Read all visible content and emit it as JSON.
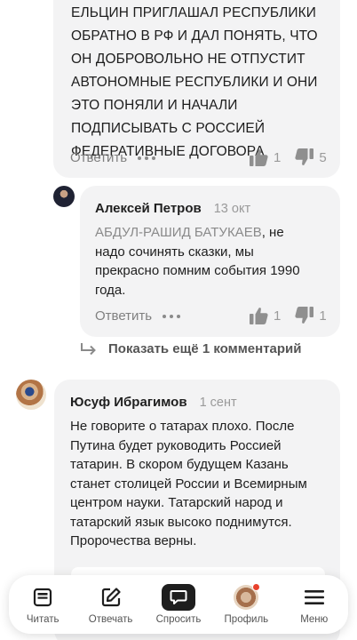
{
  "comment1": {
    "text_lines": [
      "ЕЛЬЦИН ПРИГЛАШАЛ РЕСПУБЛИКИ",
      "ОБРАТНО В РФ И ДАЛ ПОНЯТЬ, ЧТО",
      "ОН ДОБРОВОЛЬНО НЕ ОТПУСТИТ",
      "АВТОНОМНЫЕ РЕСПУБЛИКИ И ОНИ",
      "ЭТО ПОНЯЛИ И НАЧАЛИ",
      "ПОДПИСЫВАТЬ С РОССИЕЙ",
      "ФЕДЕРАТИВНЫЕ ДОГОВОРА"
    ],
    "reply_label": "Ответить",
    "likes": "1",
    "dislikes": "5"
  },
  "comment2": {
    "author": "Алексей Петров",
    "date": "13 окт",
    "mention": "АБДУЛ-РАШИД БАТУКАЕВ",
    "text_lines": [
      ", не",
      "надо сочинять сказки, мы",
      "прекрасно помним события 1990",
      "года."
    ],
    "reply_label": "Ответить",
    "likes": "1",
    "dislikes": "1"
  },
  "show_more": {
    "label": "Показать ещё 1 комментарий"
  },
  "comment3": {
    "author": "Юсуф Ибрагимов",
    "date": "1 сент",
    "text_lines": [
      "Не говорите о татарах плохо. После",
      "Путина будет руководить Россией",
      "татарин. В скором будущем Казань",
      "станет столицей России и Всемирным",
      "центром науки. Татарский народ и",
      "татарский язык высоко поднимутся.",
      "Пророчества верны."
    ]
  },
  "tabbar": {
    "items": [
      {
        "label": "Читать",
        "icon": "read-icon"
      },
      {
        "label": "Отвечать",
        "icon": "edit-icon"
      },
      {
        "label": "Спросить",
        "icon": "chat-icon"
      },
      {
        "label": "Профиль",
        "icon": "profile-avatar"
      },
      {
        "label": "Меню",
        "icon": "hamburger-icon"
      }
    ]
  }
}
